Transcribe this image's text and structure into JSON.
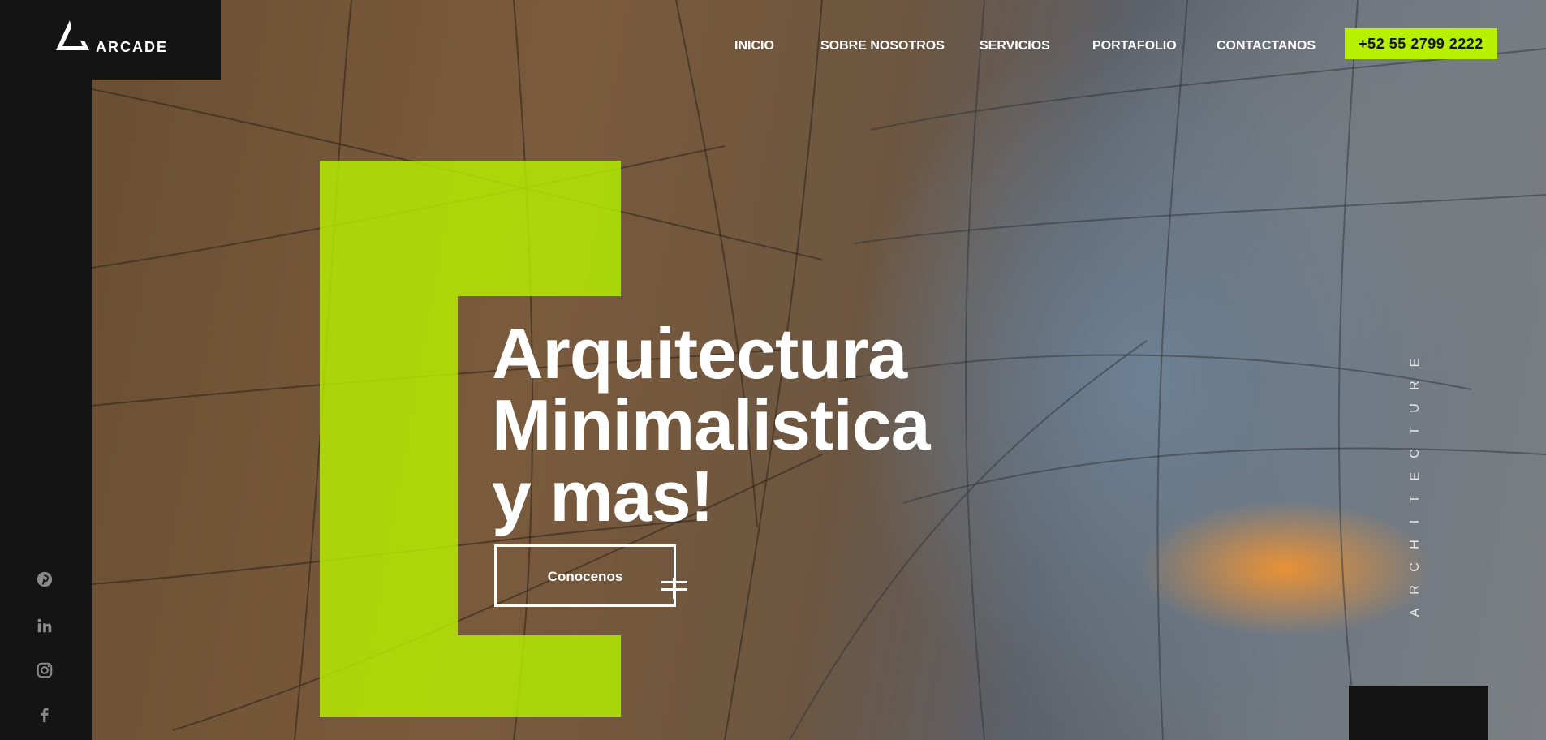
{
  "brand": {
    "name": "ARCADE",
    "logo_icon": "triangle-logo-icon"
  },
  "nav": {
    "items": [
      {
        "label": "INICIO"
      },
      {
        "label": "SOBRE NOSOTROS"
      },
      {
        "label": "SERVICIOS"
      },
      {
        "label": "PORTAFOLIO"
      },
      {
        "label": "CONTACTANOS"
      }
    ],
    "phone": "+52 55 2799 2222"
  },
  "hero": {
    "headline": [
      "Arquitectura",
      "Minimalistica",
      "y mas!"
    ],
    "cta_label": "Conocenos",
    "vertical_letters": [
      "A",
      "R",
      "C",
      "H",
      "I",
      "T",
      "E",
      "C",
      "T",
      "U",
      "R",
      "E"
    ]
  },
  "social": [
    {
      "icon": "pinterest-icon"
    },
    {
      "icon": "linkedin-icon"
    },
    {
      "icon": "instagram-icon"
    },
    {
      "icon": "facebook-icon"
    }
  ],
  "colors": {
    "accent": "#b7f000",
    "dark": "#141414",
    "text": "#ffffff"
  }
}
